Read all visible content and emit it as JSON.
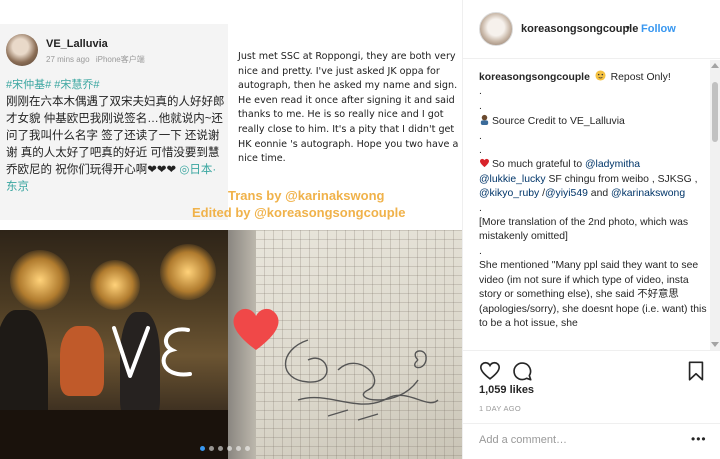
{
  "post_image": {
    "phone_card": {
      "username": "VE_Lalluvia",
      "time": "27 mins ago",
      "client": "iPhone客户端",
      "tags": "#宋仲基# #宋慧乔#",
      "body": "刚刚在六本木偶遇了双宋夫妇真的人好好郎才女貌 仲基欧巴我刚说签名…他就说内~还问了我叫什么名字 签了还读了一下 还说谢谢 真的人太好了吧真的好近 可惜没要到慧乔欧尼的 祝你们玩得开心啊❤❤❤",
      "location": "◎日本·东京"
    },
    "translation": "Just met SSC at Roppongi, they are both very nice and pretty. I've just asked JK oppa for autograph, then he asked my name and sign. He even read it once after signing it and said thanks to me. He is so really nice and I got really close to him. It's a pity that I didn't get HK eonnie 's autograph. Hope you two have a nice time.",
    "credit_trans": "Trans by @karinakswong",
    "credit_edit": "Edited by @koreasongsongcouple",
    "watermark": "VE",
    "carousel_count": 6,
    "carousel_active": 0
  },
  "header": {
    "username": "koreasongsongcouple",
    "separator": "•",
    "follow_label": "Follow"
  },
  "caption": {
    "username": "koreasongsongcouple",
    "line1": "Repost Only!",
    "dot": ".",
    "source": "Source Credit to VE_Lalluvia",
    "thanks_pre": "So much grateful to ",
    "mention1": "@ladymitha",
    "mention2": "@lukkie_lucky",
    "thanks_mid": " SF chingu from weibo , SJKSG , ",
    "mention3": "@kikyo_ruby",
    "mention4": "@yiyi549",
    "and": " and ",
    "mention5": "@karinakswong",
    "more": "[More translation of the 2nd photo, which was mistakenly omitted]",
    "mentioned": "She mentioned \"Many ppl said they want to see video (im not sure if which type of video, insta story or something else), she said 不好意思 (apologies/sorry), she doesnt hope (i.e. want) this to be a hot issue, she"
  },
  "likes": "1,059 likes",
  "time_ago": "1 DAY AGO",
  "add_comment_placeholder": "Add a comment…",
  "more_options": "•••",
  "colors": {
    "link": "#003569",
    "follow": "#3897f0",
    "credit": "#f0b24a",
    "tag": "#3aa6a0"
  }
}
